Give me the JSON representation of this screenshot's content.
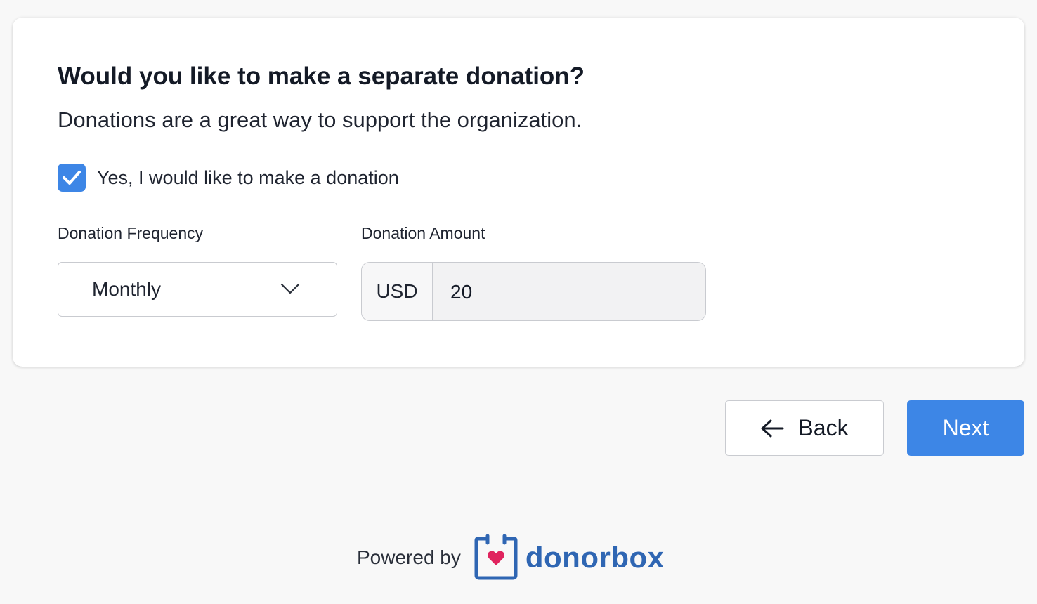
{
  "form": {
    "title": "Would you like to make a separate donation?",
    "subtitle": "Donations are a great way to support the organization.",
    "checkbox": {
      "label": "Yes, I would like to make a donation",
      "checked": true
    },
    "frequency": {
      "label": "Donation Frequency",
      "selected": "Monthly"
    },
    "amount": {
      "label": "Donation Amount",
      "currency": "USD",
      "value": "20"
    }
  },
  "nav": {
    "back_label": "Back",
    "next_label": "Next"
  },
  "footer": {
    "powered_by": "Powered by",
    "brand": "donorbox"
  },
  "colors": {
    "accent": "#3d86e6",
    "brand": "#2f66b3",
    "heart": "#e0245e"
  },
  "icons": {
    "checkbox": "check-icon",
    "select": "chevron-down-icon",
    "back": "arrow-left-icon",
    "logo": "donorbox-logo-icon"
  }
}
